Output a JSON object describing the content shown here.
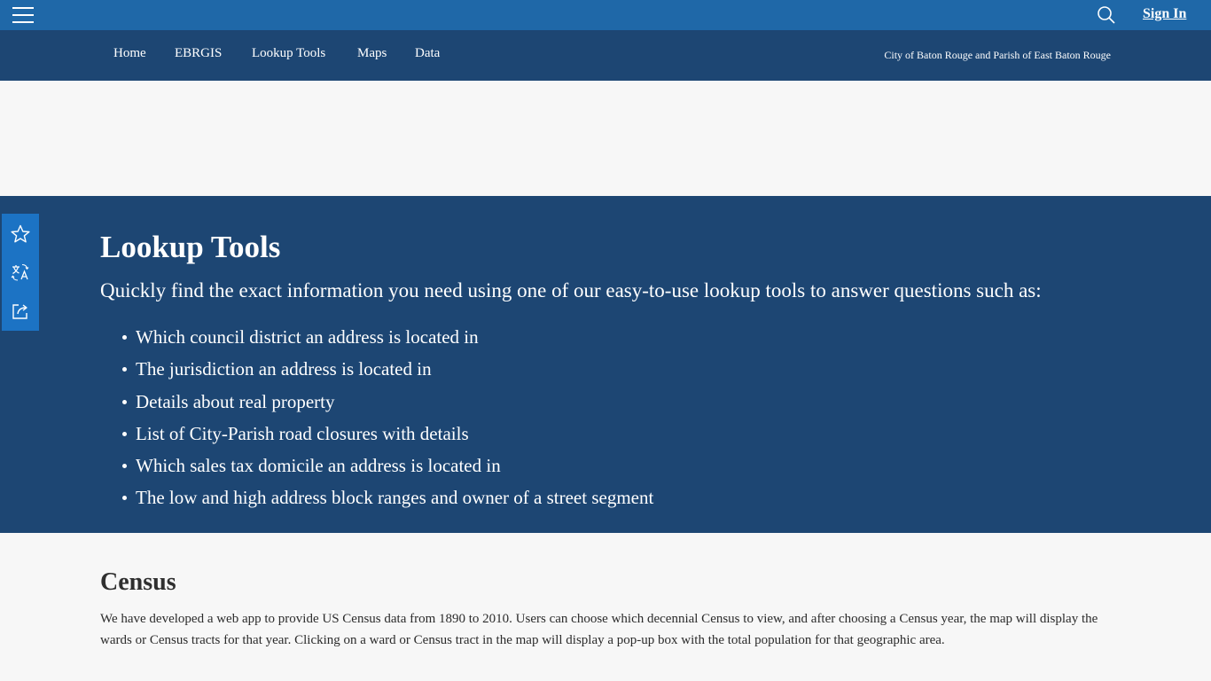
{
  "topbar": {
    "menu_icon": "hamburger-menu-icon",
    "search_icon": "search-icon",
    "sign_in_label": "Sign In",
    "background": "#1f68a8"
  },
  "nav": {
    "items": [
      {
        "label": "Home"
      },
      {
        "label": "EBRGIS"
      },
      {
        "label": "Lookup Tools"
      },
      {
        "label": "Maps"
      },
      {
        "label": "Data"
      }
    ],
    "site_name": "City of Baton Rouge and Parish of East Baton Rouge",
    "background": "#1d4673"
  },
  "side_toolbar": {
    "icons": [
      "star-icon",
      "translate-icon",
      "share-icon"
    ],
    "background": "#1c73c4"
  },
  "hero": {
    "title": "Lookup Tools",
    "lead": "Quickly find the exact information you need using one of our easy-to-use lookup tools to answer questions such as:",
    "items": [
      "Which council district an address is located in",
      "The jurisdiction an address is located in",
      "Details about real property",
      "List of City-Parish road closures with details",
      "Which sales tax domicile an address is located in",
      "The low and high address block ranges and owner of a street segment"
    ]
  },
  "census": {
    "title": "Census",
    "body": "We have developed a web app to provide US Census data from 1890 to 2010. Users can choose which decennial Census to view, and after choosing a Census year, the map will display the wards or Census tracts for that year. Clicking on a ward or Census tract in the map will display a pop-up box with the total population for that geographic area."
  }
}
